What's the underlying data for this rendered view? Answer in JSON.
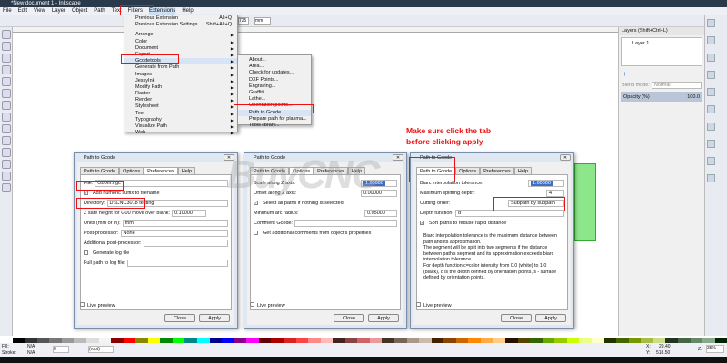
{
  "window": {
    "title": "*New document 1 - Inkscape"
  },
  "menubar": [
    "File",
    "Edit",
    "View",
    "Layer",
    "Object",
    "Path",
    "Text",
    "Filters",
    "Extensions",
    "Help"
  ],
  "toolbar": {
    "unit": "mm",
    "value": "725"
  },
  "extensions_menu": {
    "items": [
      {
        "label": "Previous Extension",
        "shortcut": "Alt+Q"
      },
      {
        "label": "Previous Extension Settings...",
        "shortcut": "Shift+Alt+Q"
      },
      {
        "label": "Arrange",
        "sub": true
      },
      {
        "label": "Color",
        "sub": true
      },
      {
        "label": "Document",
        "sub": true
      },
      {
        "label": "Export",
        "sub": true
      },
      {
        "label": "Gcodetools",
        "sub": true
      },
      {
        "label": "Generate from Path",
        "sub": true
      },
      {
        "label": "Images",
        "sub": true
      },
      {
        "label": "JessyInk",
        "sub": true
      },
      {
        "label": "Modify Path",
        "sub": true
      },
      {
        "label": "Raster",
        "sub": true
      },
      {
        "label": "Render",
        "sub": true
      },
      {
        "label": "Stylesheet",
        "sub": true
      },
      {
        "label": "Text",
        "sub": true
      },
      {
        "label": "Typography",
        "sub": true
      },
      {
        "label": "Visualize Path",
        "sub": true
      },
      {
        "label": "Web",
        "sub": true
      }
    ]
  },
  "gcodetools_menu": [
    "About...",
    "Area...",
    "Check for updates...",
    "DXF Points...",
    "Engraving...",
    "Graffiti...",
    "Lathe...",
    "Orientation points...",
    "Path to Gcode...",
    "Prepare path for plasma...",
    "Tools library..."
  ],
  "annotation": {
    "line1": "Make sure click the tab",
    "line2": "before clicking apply",
    "color": "#e11"
  },
  "dialogs": {
    "title": "Path to Gcode",
    "tabs": [
      "Path to Gcode",
      "Options",
      "Preferences",
      "Help"
    ],
    "live_preview": "Live preview",
    "close": "Close",
    "apply": "Apply",
    "prefs": {
      "file_label": "File:",
      "file_value": "ctoom.ngc",
      "add_suffix": "Add numeric suffix to filename",
      "dir_label": "Directory:",
      "dir_value": "D:\\CNC3018 testing",
      "zsafe_label": "Z safe height for G00 move over blank:",
      "zsafe_value": "0.10000",
      "units_label": "Units (mm or in):",
      "units_value": "mm",
      "post_label": "Post-processor:",
      "post_value": "None",
      "addpost_label": "Additional post-processor:",
      "genlog": "Generate log file",
      "logpath_label": "Full path to log file:"
    },
    "options": {
      "scale_label": "Scale along Z axis:",
      "scale_value": "1.00000",
      "offset_label": "Offset along Z axis:",
      "offset_value": "0.00000",
      "select_all": "Select all paths if nothing is selected",
      "minarc_label": "Minimum arc radius:",
      "minarc_value": "0.05000",
      "comment_label": "Comment Gcode:",
      "additional": "Get additional comments from object's properties"
    },
    "pathtogcode": {
      "biarc_label": "Biarc interpolation tolerance:",
      "biarc_value": "1.00000",
      "maxsplit_label": "Maximum splitting depth:",
      "maxsplit_value": "4",
      "cutting_label": "Cutting order:",
      "cutting_value": "Subpath by subpath",
      "depth_label": "Depth function:",
      "depth_value": "d",
      "sort": "Sort paths to reduse rapid distance",
      "help": [
        "Biarc interpolation tolerance is the maximum distance between path and its approximation.",
        "The segment will be split into two segments if the distance between path's segment and its approximation exceeds biarc interpolation tolerance.",
        "For depth function c=color intensity from 0.0 (white) to 1.0 (black), d is the depth defined by orientation points, s - surface defined by orientation points."
      ]
    }
  },
  "layers": {
    "title": "Layers (Shift+Ctrl+L)",
    "layer": "Layer 1",
    "blend_label": "Blend mode:",
    "blend_value": "Normal",
    "opacity_label": "Opacity (%)",
    "opacity_value": "100.0"
  },
  "status": {
    "fill_label": "Fill:",
    "fill_value": "N/A",
    "stroke_label": "Stroke:",
    "stroke_value": "N/A",
    "opacity": "0",
    "layer": "(root)",
    "x_label": "X:",
    "x": "29.40",
    "y_label": "Y:",
    "y": "518.50",
    "z_label": "Z:",
    "zoom": "35%"
  },
  "watermark": "BuyCNC"
}
